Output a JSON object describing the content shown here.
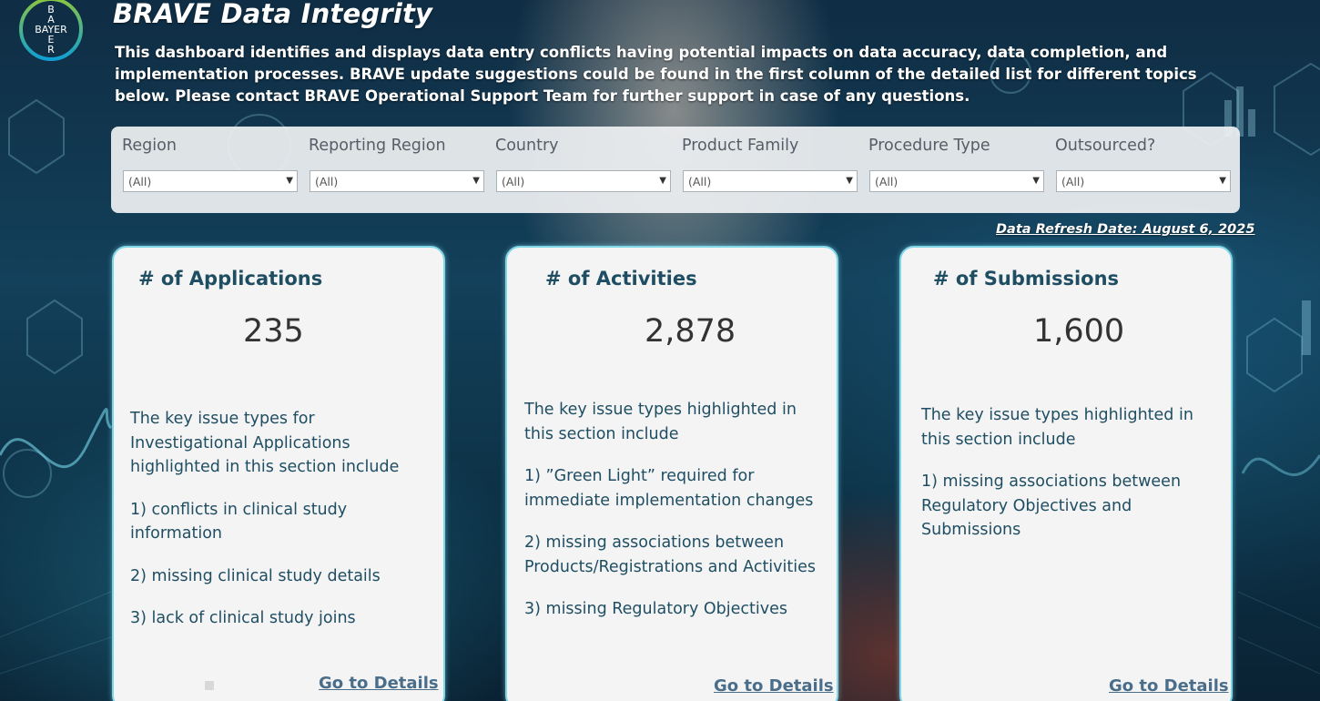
{
  "header": {
    "logo_text": "BAYER",
    "title": "BRAVE Data Integrity",
    "description": "This dashboard identifies and displays data entry conflicts having potential impacts on data accuracy, data completion, and implementation processes. BRAVE update suggestions could be found in the first column of the detailed list for different topics below. Please contact BRAVE Operational Support Team for further support in case of any questions."
  },
  "filters": [
    {
      "label": "Region",
      "value": "(All)"
    },
    {
      "label": "Reporting Region",
      "value": "(All)"
    },
    {
      "label": "Country",
      "value": "(All)"
    },
    {
      "label": "Product Family",
      "value": "(All)"
    },
    {
      "label": "Procedure Type",
      "value": "(All)"
    },
    {
      "label": "Outsourced?",
      "value": "(All)"
    }
  ],
  "refresh_date": "Data Refresh Date: August 6, 2025",
  "cards": [
    {
      "title": "# of Applications",
      "value": "235",
      "paragraphs": [
        "The key issue types for Investigational Applications highlighted in this section include",
        "1) conflicts in clinical study information",
        "2) missing clinical study details",
        "3) lack of clinical study joins"
      ],
      "link": "Go to Details"
    },
    {
      "title": "# of Activities",
      "value": "2,878",
      "paragraphs": [
        "The key issue types highlighted in this section include",
        "1) ”Green Light” required for immediate implementation changes",
        "2) missing associations between Products/Registrations and Activities",
        "3) missing Regulatory Objectives"
      ],
      "link": "Go to Details"
    },
    {
      "title": "# of Submissions",
      "value": "1,600",
      "paragraphs": [
        "The key issue types highlighted in this section include",
        "1) missing associations between Regulatory Objectives and Submissions"
      ],
      "link": "Go to Details"
    }
  ],
  "colors": {
    "card_title": "#1f4e63",
    "card_border": "#7fd6e6",
    "link": "#4a6e8a",
    "logo_ring_top": "#89c541",
    "logo_ring_bottom": "#10a0d4"
  },
  "icons": [
    "bayer-logo",
    "dropdown-caret-icon"
  ]
}
